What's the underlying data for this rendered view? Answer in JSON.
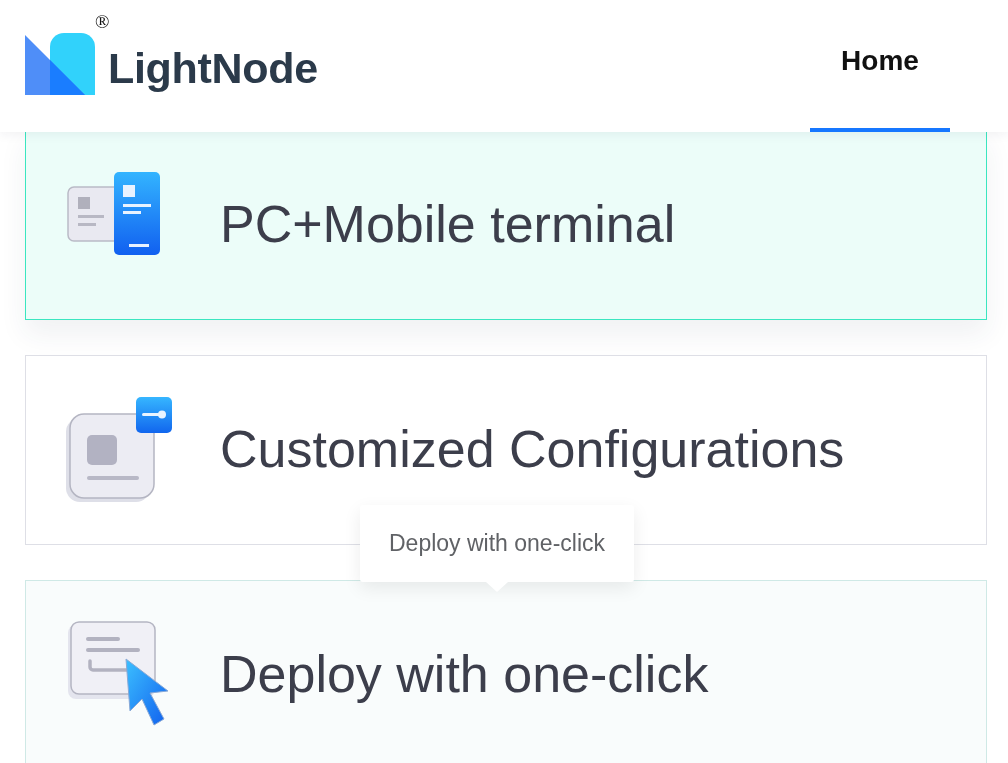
{
  "brand": {
    "name": "LightNode",
    "registered_mark": "®"
  },
  "nav": [
    {
      "label": "Home",
      "selected": true
    }
  ],
  "features": [
    {
      "title": "PC+Mobile terminal",
      "selected": true,
      "hovered": false
    },
    {
      "title": "Customized Configurations",
      "selected": false,
      "hovered": false
    },
    {
      "title": "Deploy with one-click",
      "selected": false,
      "hovered": true
    }
  ],
  "tooltip": {
    "text": "Deploy with one-click"
  }
}
